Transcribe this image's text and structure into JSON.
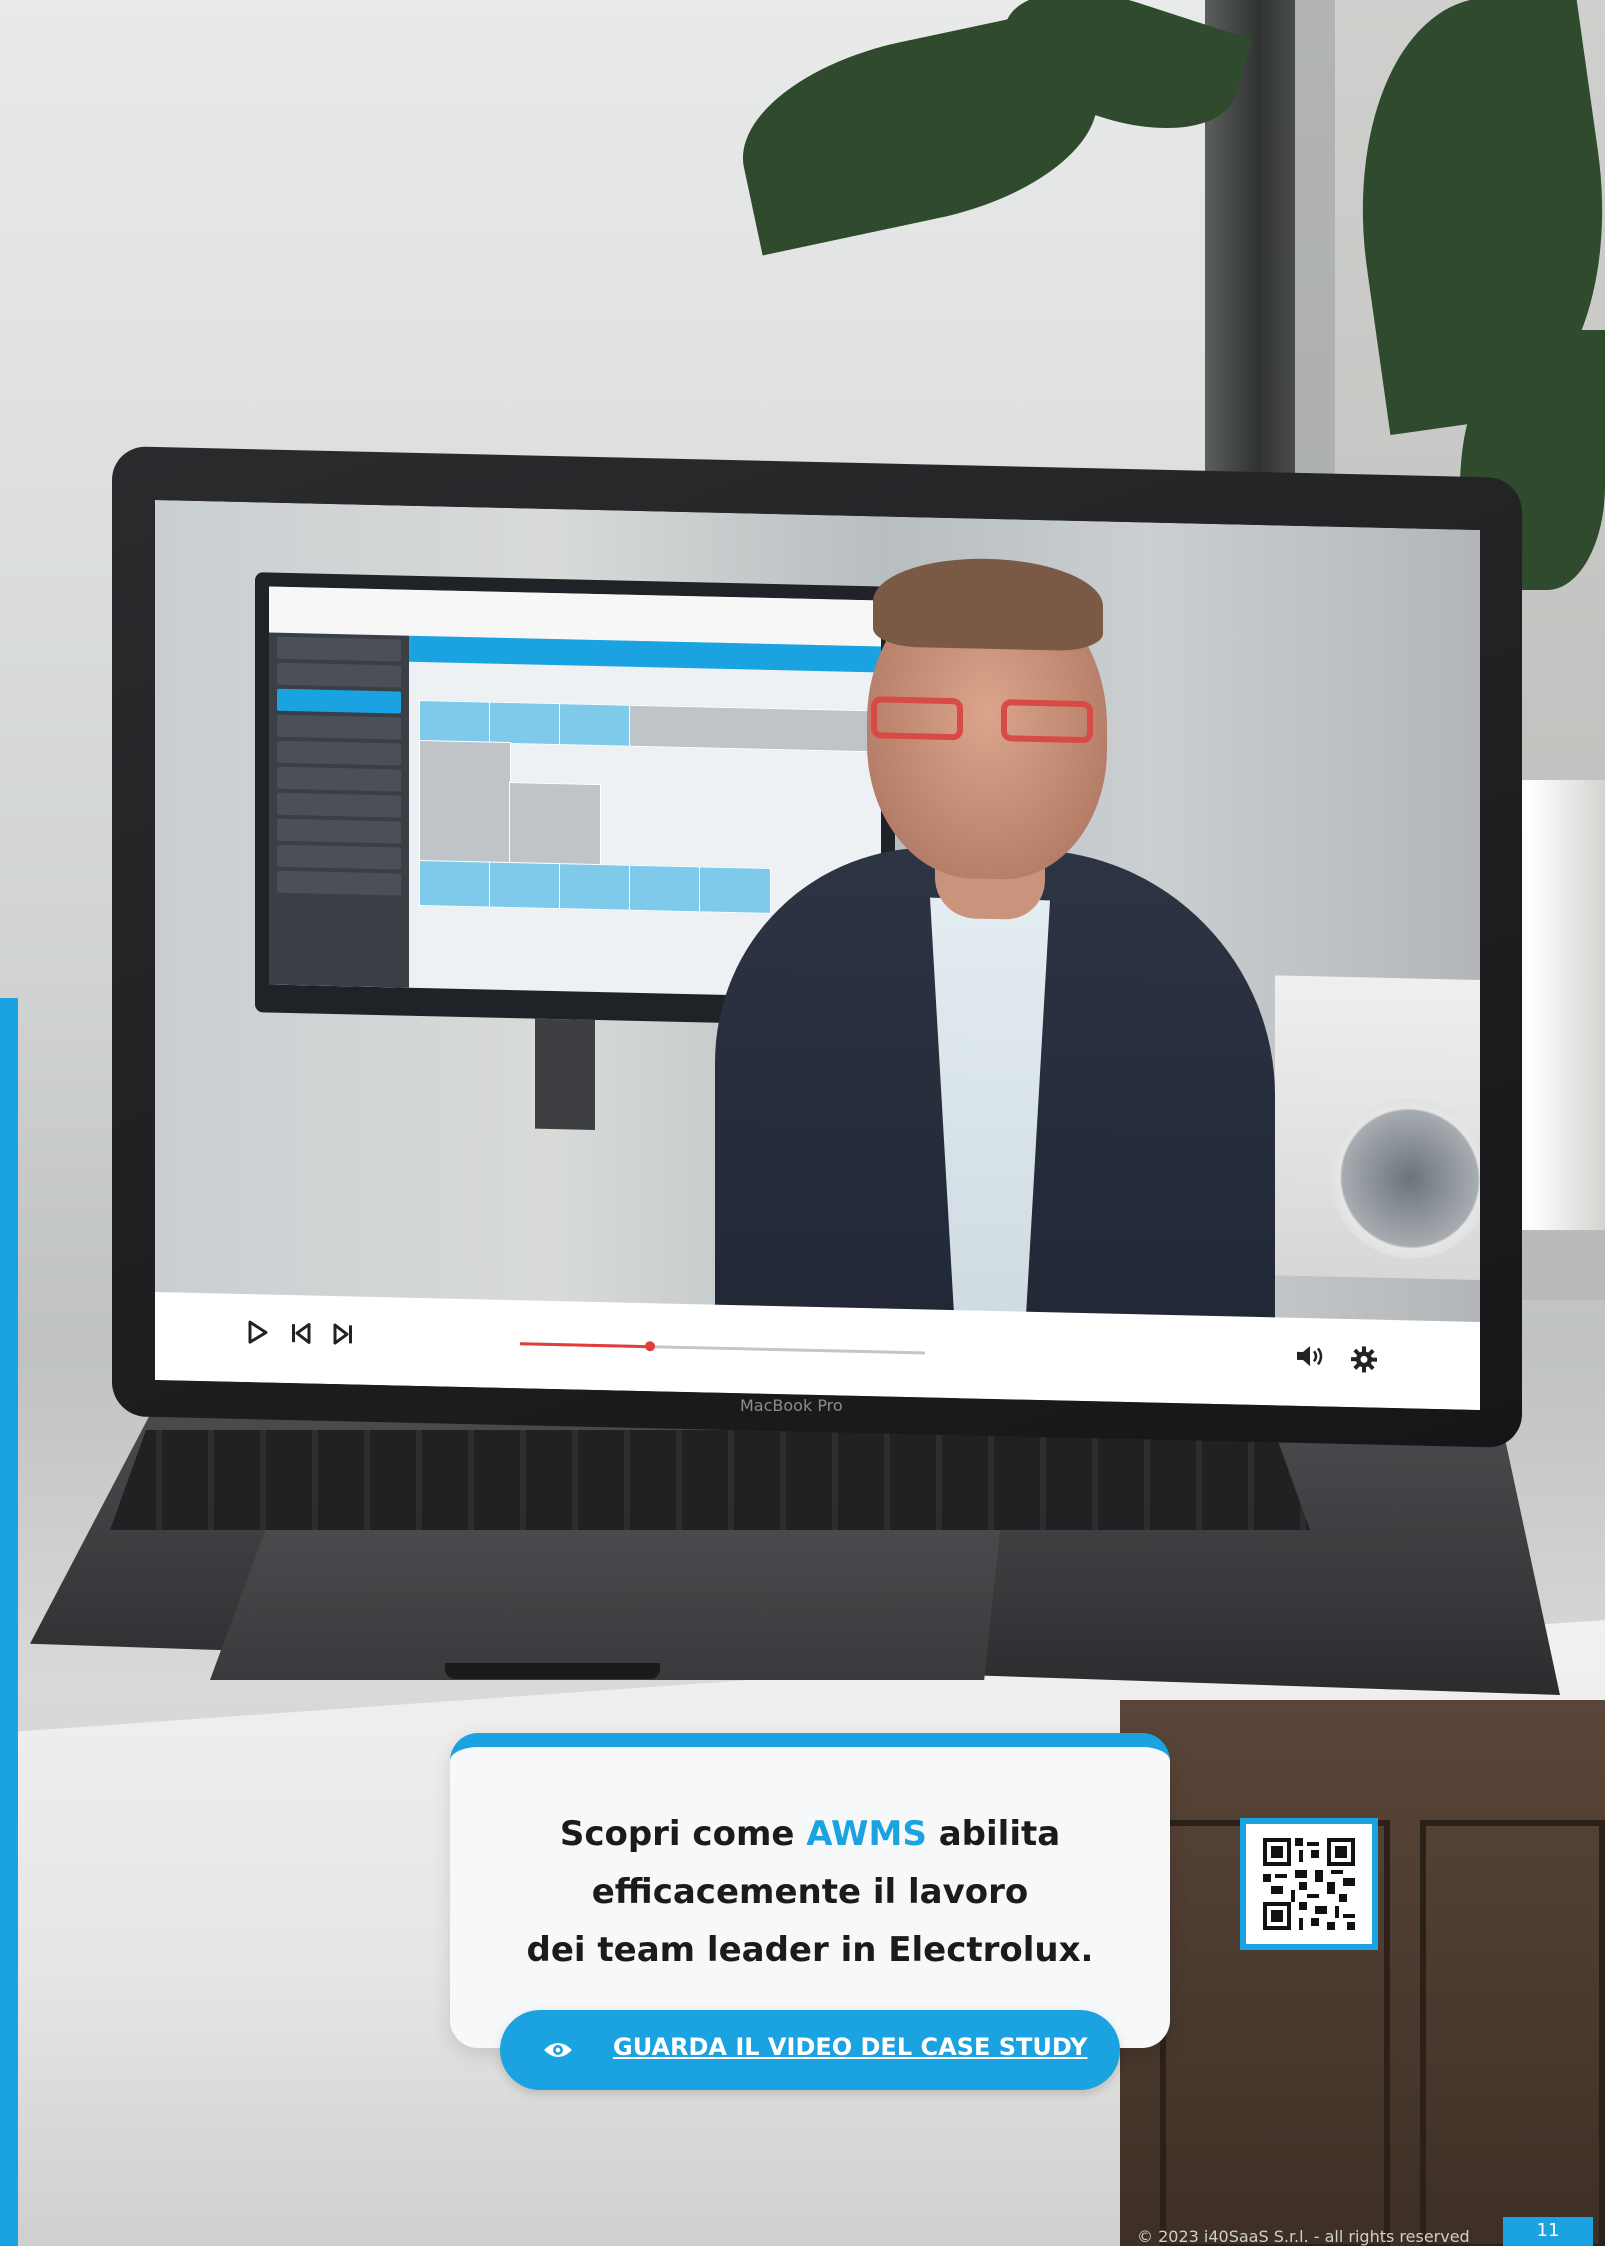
{
  "scene": {
    "description_icons": [
      "plant",
      "window",
      "laptop",
      "cabinet"
    ]
  },
  "video_player": {
    "controls": {
      "play_icon": "play-icon",
      "prev_icon": "skip-back-icon",
      "next_icon": "skip-forward-icon",
      "volume_icon": "volume-icon",
      "settings_icon": "gear-icon"
    },
    "progress": 0.32
  },
  "laptop": {
    "brand": "MacBook Pro"
  },
  "cta": {
    "line1_prefix": "Scopri come ",
    "line1_accent": "AWMS",
    "line1_suffix": " abilita",
    "line2": "efficacemente il lavoro",
    "line3": "dei team leader in Electrolux.",
    "button_label": "GUARDA IL VIDEO DEL CASE STUDY",
    "button_icon": "eye-icon"
  },
  "qr": {
    "icon": "qr-code-icon"
  },
  "footer": {
    "copyright": "© 2023 i40SaaS S.r.l. - all rights reserved",
    "page_number": "11"
  },
  "colors": {
    "accent": "#1aa3e0",
    "progress": "#e23d3d",
    "text_dark": "#1b1b1b"
  }
}
